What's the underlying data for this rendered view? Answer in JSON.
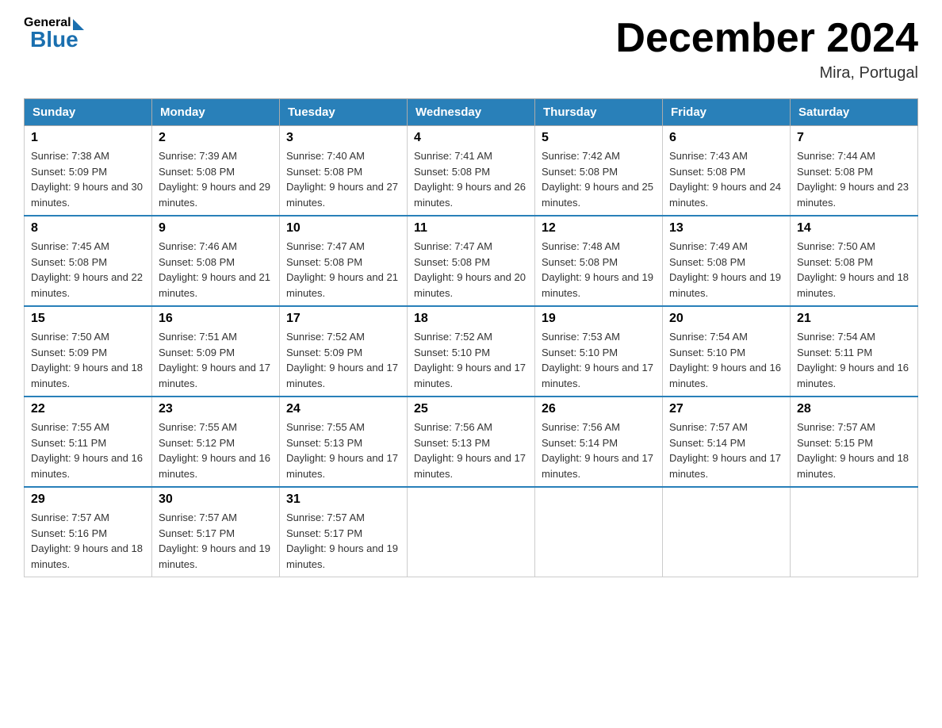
{
  "header": {
    "logo": {
      "general": "General",
      "blue": "Blue"
    },
    "title": "December 2024",
    "location": "Mira, Portugal"
  },
  "calendar": {
    "days_of_week": [
      "Sunday",
      "Monday",
      "Tuesday",
      "Wednesday",
      "Thursday",
      "Friday",
      "Saturday"
    ],
    "weeks": [
      [
        {
          "day": "1",
          "sunrise": "7:38 AM",
          "sunset": "5:09 PM",
          "daylight": "9 hours and 30 minutes."
        },
        {
          "day": "2",
          "sunrise": "7:39 AM",
          "sunset": "5:08 PM",
          "daylight": "9 hours and 29 minutes."
        },
        {
          "day": "3",
          "sunrise": "7:40 AM",
          "sunset": "5:08 PM",
          "daylight": "9 hours and 27 minutes."
        },
        {
          "day": "4",
          "sunrise": "7:41 AM",
          "sunset": "5:08 PM",
          "daylight": "9 hours and 26 minutes."
        },
        {
          "day": "5",
          "sunrise": "7:42 AM",
          "sunset": "5:08 PM",
          "daylight": "9 hours and 25 minutes."
        },
        {
          "day": "6",
          "sunrise": "7:43 AM",
          "sunset": "5:08 PM",
          "daylight": "9 hours and 24 minutes."
        },
        {
          "day": "7",
          "sunrise": "7:44 AM",
          "sunset": "5:08 PM",
          "daylight": "9 hours and 23 minutes."
        }
      ],
      [
        {
          "day": "8",
          "sunrise": "7:45 AM",
          "sunset": "5:08 PM",
          "daylight": "9 hours and 22 minutes."
        },
        {
          "day": "9",
          "sunrise": "7:46 AM",
          "sunset": "5:08 PM",
          "daylight": "9 hours and 21 minutes."
        },
        {
          "day": "10",
          "sunrise": "7:47 AM",
          "sunset": "5:08 PM",
          "daylight": "9 hours and 21 minutes."
        },
        {
          "day": "11",
          "sunrise": "7:47 AM",
          "sunset": "5:08 PM",
          "daylight": "9 hours and 20 minutes."
        },
        {
          "day": "12",
          "sunrise": "7:48 AM",
          "sunset": "5:08 PM",
          "daylight": "9 hours and 19 minutes."
        },
        {
          "day": "13",
          "sunrise": "7:49 AM",
          "sunset": "5:08 PM",
          "daylight": "9 hours and 19 minutes."
        },
        {
          "day": "14",
          "sunrise": "7:50 AM",
          "sunset": "5:08 PM",
          "daylight": "9 hours and 18 minutes."
        }
      ],
      [
        {
          "day": "15",
          "sunrise": "7:50 AM",
          "sunset": "5:09 PM",
          "daylight": "9 hours and 18 minutes."
        },
        {
          "day": "16",
          "sunrise": "7:51 AM",
          "sunset": "5:09 PM",
          "daylight": "9 hours and 17 minutes."
        },
        {
          "day": "17",
          "sunrise": "7:52 AM",
          "sunset": "5:09 PM",
          "daylight": "9 hours and 17 minutes."
        },
        {
          "day": "18",
          "sunrise": "7:52 AM",
          "sunset": "5:10 PM",
          "daylight": "9 hours and 17 minutes."
        },
        {
          "day": "19",
          "sunrise": "7:53 AM",
          "sunset": "5:10 PM",
          "daylight": "9 hours and 17 minutes."
        },
        {
          "day": "20",
          "sunrise": "7:54 AM",
          "sunset": "5:10 PM",
          "daylight": "9 hours and 16 minutes."
        },
        {
          "day": "21",
          "sunrise": "7:54 AM",
          "sunset": "5:11 PM",
          "daylight": "9 hours and 16 minutes."
        }
      ],
      [
        {
          "day": "22",
          "sunrise": "7:55 AM",
          "sunset": "5:11 PM",
          "daylight": "9 hours and 16 minutes."
        },
        {
          "day": "23",
          "sunrise": "7:55 AM",
          "sunset": "5:12 PM",
          "daylight": "9 hours and 16 minutes."
        },
        {
          "day": "24",
          "sunrise": "7:55 AM",
          "sunset": "5:13 PM",
          "daylight": "9 hours and 17 minutes."
        },
        {
          "day": "25",
          "sunrise": "7:56 AM",
          "sunset": "5:13 PM",
          "daylight": "9 hours and 17 minutes."
        },
        {
          "day": "26",
          "sunrise": "7:56 AM",
          "sunset": "5:14 PM",
          "daylight": "9 hours and 17 minutes."
        },
        {
          "day": "27",
          "sunrise": "7:57 AM",
          "sunset": "5:14 PM",
          "daylight": "9 hours and 17 minutes."
        },
        {
          "day": "28",
          "sunrise": "7:57 AM",
          "sunset": "5:15 PM",
          "daylight": "9 hours and 18 minutes."
        }
      ],
      [
        {
          "day": "29",
          "sunrise": "7:57 AM",
          "sunset": "5:16 PM",
          "daylight": "9 hours and 18 minutes."
        },
        {
          "day": "30",
          "sunrise": "7:57 AM",
          "sunset": "5:17 PM",
          "daylight": "9 hours and 19 minutes."
        },
        {
          "day": "31",
          "sunrise": "7:57 AM",
          "sunset": "5:17 PM",
          "daylight": "9 hours and 19 minutes."
        },
        null,
        null,
        null,
        null
      ]
    ]
  }
}
